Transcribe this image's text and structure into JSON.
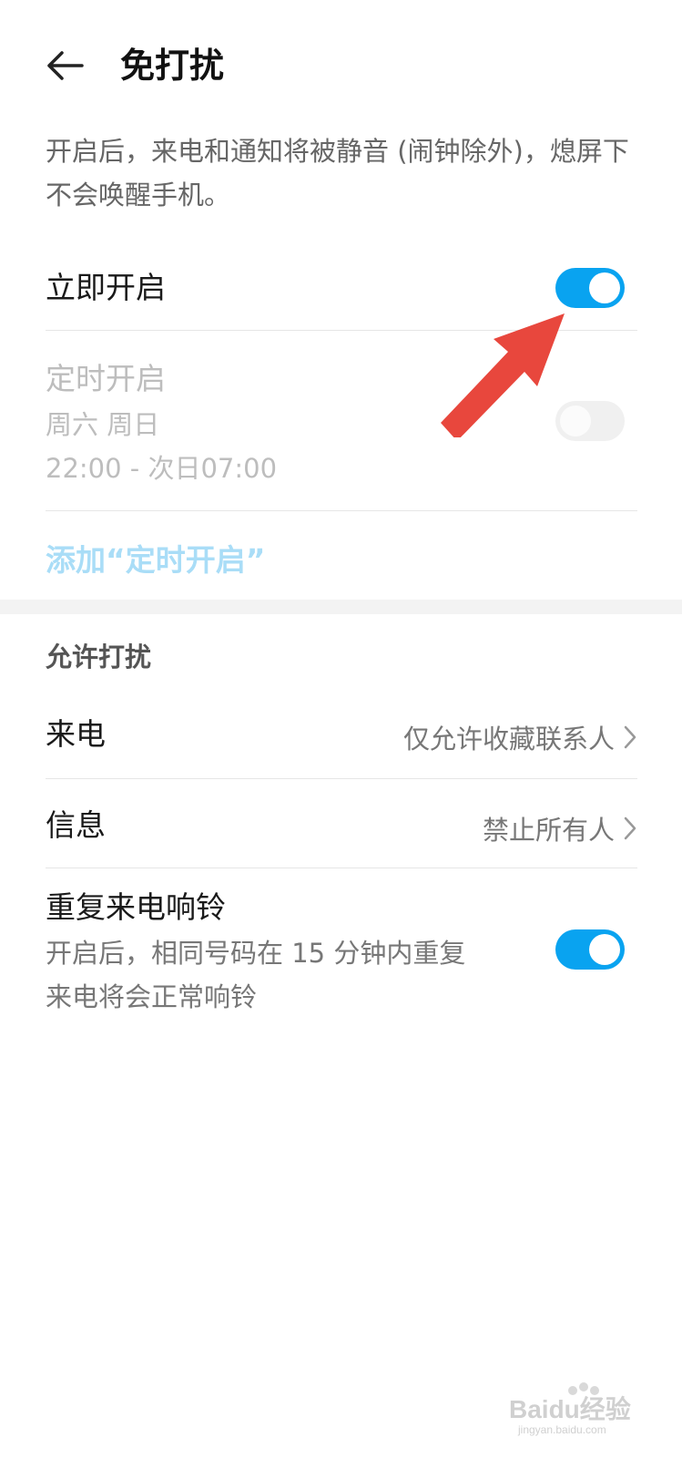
{
  "header": {
    "title": "免打扰",
    "back_icon": "arrow-left-icon"
  },
  "description": "开启后，来电和通知将被静音 (闹钟除外)，熄屏下不会唤醒手机。",
  "immediate": {
    "label": "立即开启",
    "enabled": true
  },
  "scheduled": {
    "label": "定时开启",
    "days": "周六 周日",
    "time": "22:00 - 次日07:00",
    "enabled": false
  },
  "add_schedule": {
    "label": "添加“定时开启”"
  },
  "allow_section": {
    "title": "允许打扰",
    "calls": {
      "label": "来电",
      "value": "仅允许收藏联系人"
    },
    "messages": {
      "label": "信息",
      "value": "禁止所有人"
    },
    "repeat": {
      "label": "重复来电响铃",
      "desc_line1": "开启后，相同号码在 15 分钟内重复",
      "desc_line2": "来电将会正常响铃",
      "enabled": true
    }
  },
  "colors": {
    "accent": "#09a3f0",
    "annotation_arrow": "#e8473d"
  },
  "watermark": {
    "text": "Baidu经验",
    "sub": "jingyan.baidu.com"
  }
}
